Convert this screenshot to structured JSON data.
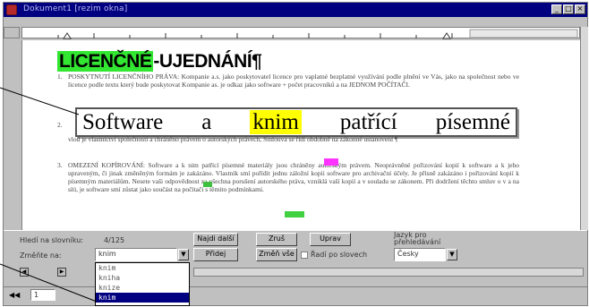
{
  "window": {
    "title": "Dokument1 [rezim okna]"
  },
  "document": {
    "heading_highlight": "LICENČNÉ",
    "heading_rest": "-UJEDNÁNÍ¶",
    "item1_number": "1.",
    "item1_text": "POSKYTNUTÍ LICENČNÍHO PRÁVA: Kompanie a.s. jako poskytovatel licence pro vaplatné bezplatné využívání podle plnění ve Vás, jako na společnost nebo ve licence podle textu který bude poskytovat Kompanie as. je odkaz jako software + počet pracovníků a na JEDNOM POČÍTAČI.",
    "item2_number": "2.",
    "magnified_before": "Software a",
    "magnified_highlight": "knim",
    "magnified_after": "patřící písemné",
    "item2_text": "vlod je vlastnictví společnosti a chráněno právem o autorských právech, Smlouva se řídí obdobně na zákonné ustanovení ¶",
    "item3_number": "3.",
    "item3_text": "OMEZENÍ KOPÍROVÁNÍ: Software a k nim patřící písemné materiály jsou chráněny autorským právem. Neoprávněné pořizování kopií k software a k jeho upraveným, či jinak změněným formám je zakázáno. Vlastník smí pořídit jednu záložní kopii software pro archivační účely. Je přísně zakázáno i pořizování kopií k písemným materiálům. Nesete vaši odpovědnost za všechna porušení autorského práva, vzniklá vaší kopií a v souladu se zákonem. Při dodržení těchto smluv o v a na síti, je software smí zůstat jako součást na počítači s těmito podmínkami."
  },
  "panel": {
    "hits_label": "Hledí na slovníku:",
    "hits_value": "4/125",
    "btn_find": "Najdi další",
    "btn_skip": "Zruš",
    "btn_edit": "Uprav",
    "lang_label_line1": "Jazyk pro",
    "lang_label_line2": "přehledávání",
    "replace_label": "Změňte na:",
    "replace_value": "knim",
    "btn_add": "Přidej",
    "btn_change_all": "Změň vše",
    "checkbox_label": "Řadí po slovech",
    "lang_value": "Česky"
  },
  "dropdown": {
    "options": [
      "knim",
      "kniha",
      "knize",
      "knim"
    ]
  },
  "statusbar": {
    "page_field": "1"
  },
  "colors": {
    "titlebar": "#000080",
    "heading_highlight": "#32e632",
    "magnified_highlight": "#ffff00",
    "marker_magenta": "#ff33ff",
    "marker_green": "#40c040"
  },
  "icons": [
    "app-icon",
    "minimize-icon",
    "maximize-icon",
    "close-icon",
    "dropdown-arrow-icon",
    "scroll-left-icon",
    "scroll-right-icon"
  ]
}
